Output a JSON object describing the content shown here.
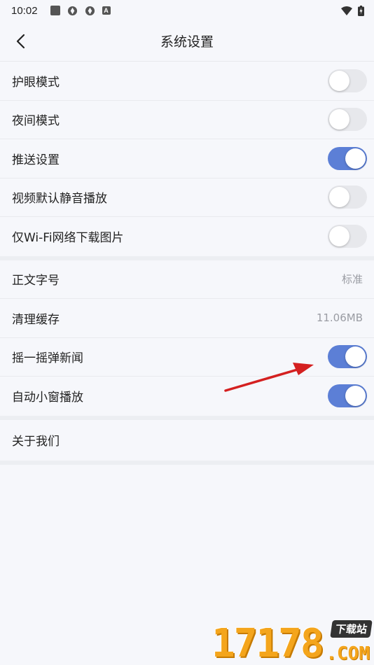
{
  "status_bar": {
    "time": "10:02",
    "a_icon_label": "A"
  },
  "header": {
    "title": "系统设置"
  },
  "settings": {
    "eye_care": {
      "label": "护眼模式",
      "on": false
    },
    "night_mode": {
      "label": "夜间模式",
      "on": false
    },
    "push": {
      "label": "推送设置",
      "on": true
    },
    "video_mute": {
      "label": "视频默认静音播放",
      "on": false
    },
    "wifi_only_images": {
      "label": "仅Wi-Fi网络下载图片",
      "on": false
    },
    "font_size": {
      "label": "正文字号",
      "value": "标准"
    },
    "clear_cache": {
      "label": "清理缓存",
      "value": "11.06MB"
    },
    "shake_news": {
      "label": "摇一摇弹新闻",
      "on": true
    },
    "mini_window": {
      "label": "自动小窗播放",
      "on": true
    },
    "about": {
      "label": "关于我们"
    }
  },
  "colors": {
    "toggle_on": "#5c7fd6",
    "toggle_off": "#e7e8ec",
    "annotation_arrow": "#d42020",
    "watermark": "#f4a51c"
  },
  "watermark": {
    "digits": "17178",
    "badge": "下载站",
    "domain": ".COM"
  }
}
